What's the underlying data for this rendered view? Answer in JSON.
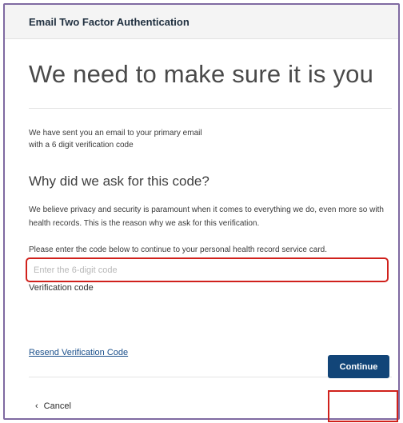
{
  "header": {
    "title": "Email Two Factor Authentication"
  },
  "main": {
    "headline": "We need to make sure it is you",
    "intro_line1": "We have sent you an email to your primary email",
    "intro_line2": "with a 6 digit verification code",
    "why_heading": "Why did we ask for this code?",
    "why_paragraph": "We believe privacy and security is paramount when it comes to everything we do, even more so with health records. This is the reason why we ask for this verification.",
    "instruction": "Please enter the code below to continue to your personal health record service card.",
    "code_field": {
      "label": "Verification code",
      "placeholder": "Enter the 6-digit code",
      "value": ""
    },
    "resend_link": "Resend Verification Code"
  },
  "footer": {
    "cancel_label": "Cancel",
    "continue_label": "Continue"
  },
  "colors": {
    "header_bg": "#f4f4f4",
    "modal_border": "#7f6aa1",
    "highlight_red": "#d0211c",
    "primary_button": "#124578",
    "link": "#1a4f8b"
  }
}
